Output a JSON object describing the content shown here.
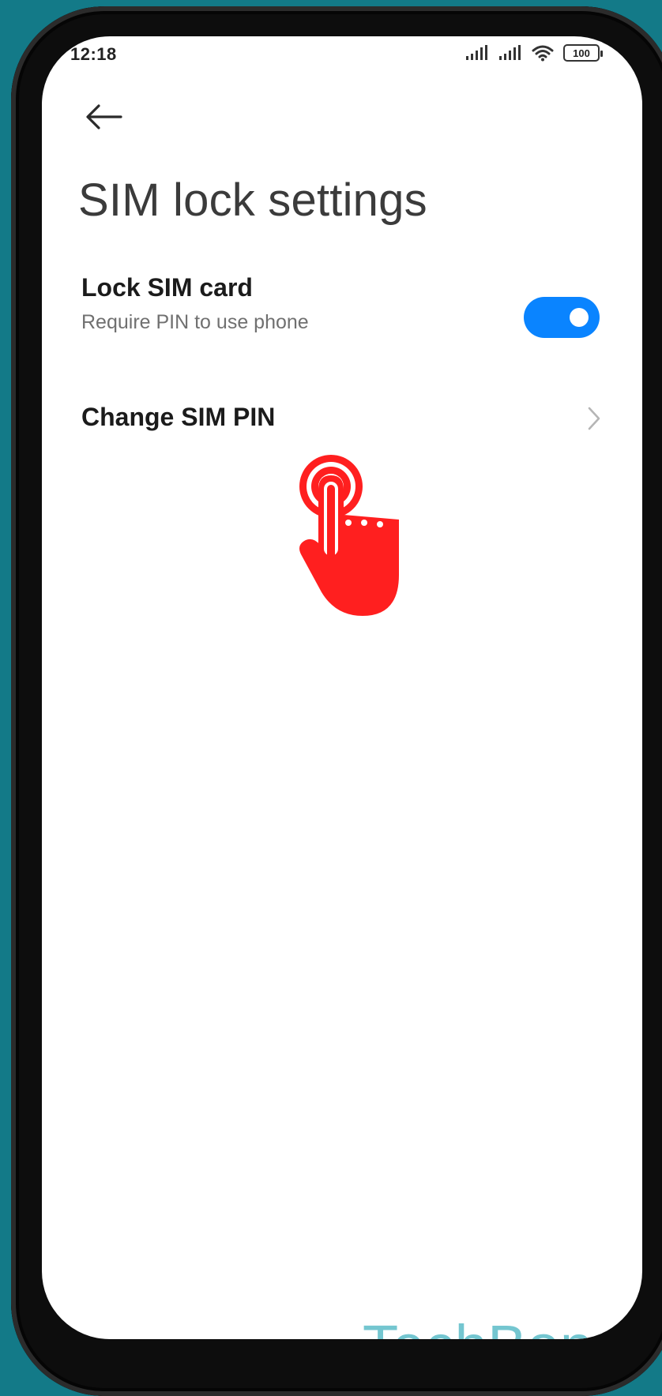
{
  "status_bar": {
    "time": "12:18",
    "battery": "100",
    "icons": [
      "signal-icon",
      "signal-icon",
      "wifi-icon",
      "battery-icon"
    ]
  },
  "header": {
    "back_icon": "back-arrow-icon",
    "title": "SIM lock settings"
  },
  "settings": {
    "lock_sim": {
      "title": "Lock SIM card",
      "subtitle": "Require PIN to use phone",
      "enabled": true
    },
    "change_pin": {
      "title": "Change SIM PIN",
      "icon": "chevron-right-icon"
    }
  },
  "overlay": {
    "tap_icon": "tap-hand-icon"
  },
  "watermark": {
    "text": "TechBone"
  },
  "colors": {
    "accent": "#0a84ff",
    "tap_indicator": "#ff1f1f",
    "watermark": "#74c6d0",
    "background": "#137a88"
  }
}
